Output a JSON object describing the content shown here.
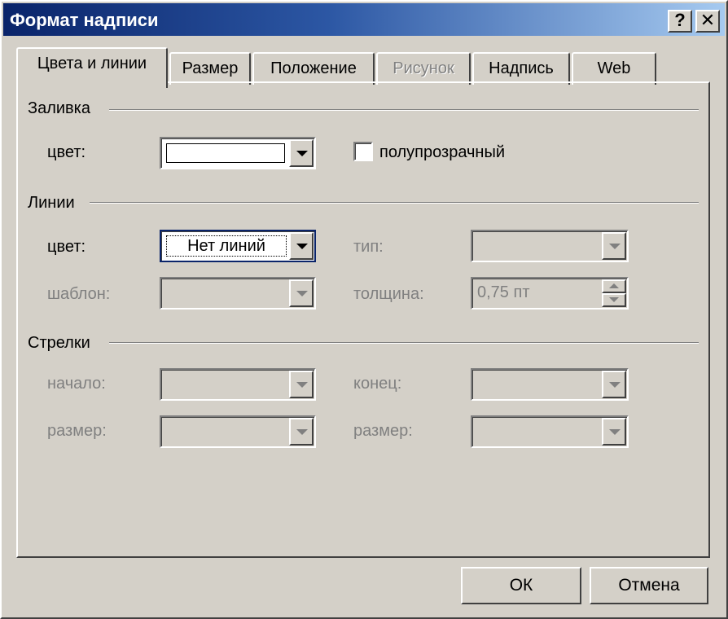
{
  "window": {
    "title": "Формат надписи",
    "help_label": "?",
    "close_label": "✕"
  },
  "tabs": [
    {
      "label": "Цвета и линии",
      "state": "active"
    },
    {
      "label": "Размер",
      "state": "normal"
    },
    {
      "label": "Положение",
      "state": "normal"
    },
    {
      "label": "Рисунок",
      "state": "disabled"
    },
    {
      "label": "Надпись",
      "state": "normal"
    },
    {
      "label": "Web",
      "state": "normal"
    }
  ],
  "fill": {
    "group_label": "Заливка",
    "color_label": "цвет:",
    "color_value": "#ffffff",
    "semi_transparent_label": "полупрозрачный",
    "semi_transparent_checked": false
  },
  "lines": {
    "group_label": "Линии",
    "color_label": "цвет:",
    "color_value": "Нет линий",
    "type_label": "тип:",
    "pattern_label": "шаблон:",
    "weight_label": "толщина:",
    "weight_value": "0,75 пт"
  },
  "arrows": {
    "group_label": "Стрелки",
    "begin_label": "начало:",
    "end_label": "конец:",
    "begin_size_label": "размер:",
    "end_size_label": "размер:"
  },
  "buttons": {
    "ok_label": "ОК",
    "cancel_label": "Отмена"
  }
}
